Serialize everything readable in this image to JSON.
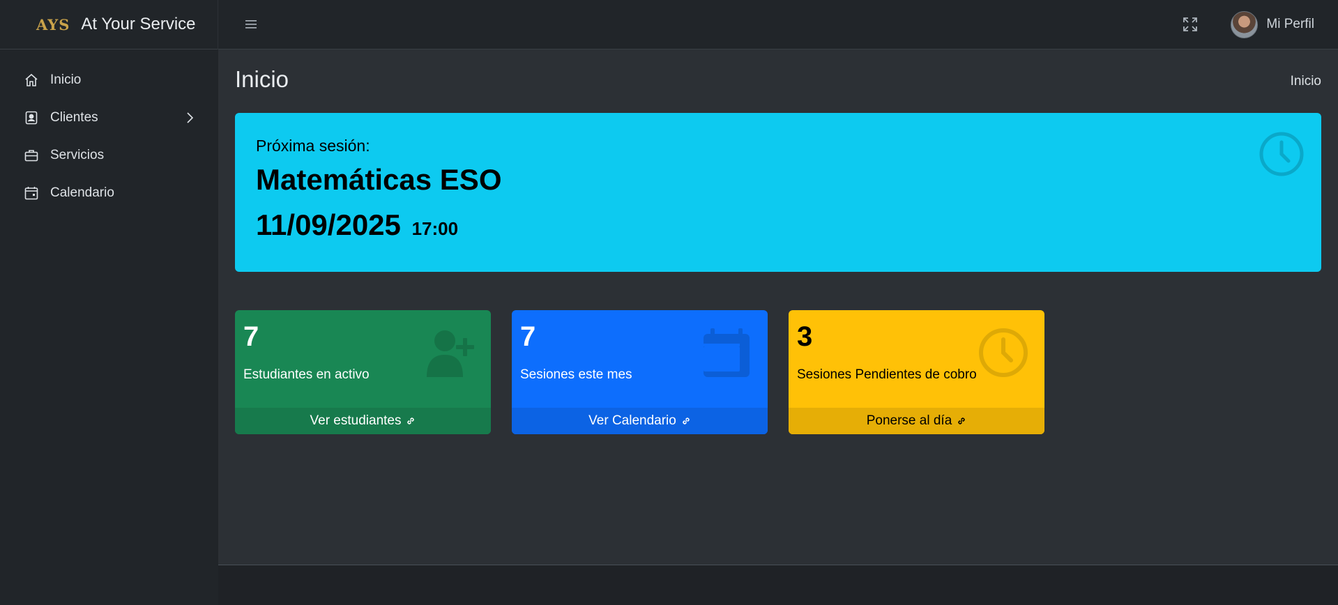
{
  "brand": {
    "logo": "AYS",
    "name": "At Your Service"
  },
  "header": {
    "profile_label": "Mi Perfil"
  },
  "sidebar": {
    "items": [
      {
        "label": "Inicio",
        "icon": "home-icon"
      },
      {
        "label": "Clientes",
        "icon": "contact-card-icon",
        "has_submenu": true
      },
      {
        "label": "Servicios",
        "icon": "briefcase-icon"
      },
      {
        "label": "Calendario",
        "icon": "calendar-icon"
      }
    ]
  },
  "page": {
    "title": "Inicio",
    "breadcrumb": "Inicio"
  },
  "next_session": {
    "label": "Próxima sesión:",
    "title": "Matemáticas ESO",
    "date": "11/09/2025",
    "time": "17:00",
    "color": "#0dcaf0"
  },
  "cards": [
    {
      "value": "7",
      "label": "Estudiantes en activo",
      "link": "Ver estudiantes",
      "color": "#198754",
      "icon": "user-plus-icon"
    },
    {
      "value": "7",
      "label": "Sesiones este mes",
      "link": "Ver Calendario",
      "color": "#0d6efd",
      "icon": "calendar-icon"
    },
    {
      "value": "3",
      "label": "Sesiones Pendientes de cobro",
      "link": "Ponerse al día",
      "color": "#ffc107",
      "icon": "clock-icon"
    }
  ]
}
